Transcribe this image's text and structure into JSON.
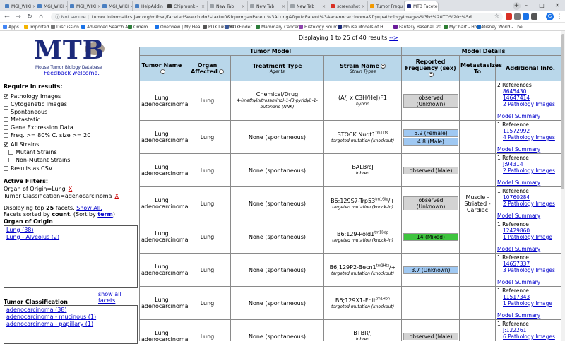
{
  "browser": {
    "tabs": [
      {
        "title": "MGI_WIKI",
        "color": "#4a7fc1"
      },
      {
        "title": "MGI_WIKI",
        "color": "#4a7fc1"
      },
      {
        "title": "MGI_WIKI",
        "color": "#4a7fc1"
      },
      {
        "title": "MGI_WIKI",
        "color": "#4a7fc1"
      },
      {
        "title": "HelpAddin",
        "color": "#4a7fc1"
      },
      {
        "title": "Chipmunk -",
        "color": "#444444"
      },
      {
        "title": "New Tab",
        "color": "#9aa0a6"
      },
      {
        "title": "New Tab",
        "color": "#9aa0a6"
      },
      {
        "title": "New Tab",
        "color": "#9aa0a6"
      },
      {
        "title": "screenshot",
        "color": "#d93025"
      },
      {
        "title": "Tumor Frequ",
        "color": "#f29900"
      },
      {
        "title": "MTB Facete",
        "color": "#1c2a7a"
      }
    ],
    "secure_label": "Not secure",
    "url": "tumor.informatics.jax.org/mtbwi/facetedSearch.do?start=0&fq=organParent%3ALung&fq=tcParent%3Aadenocarcinoma&fq=pathologyImages%3b*%20TO%20*%5d",
    "avatar_letter": "G",
    "bookmarks": [
      {
        "label": "Apps",
        "color": "#4285f4"
      },
      {
        "label": "Imported",
        "color": "#f4b400"
      },
      {
        "label": "Discussion",
        "color": "#777777"
      },
      {
        "label": "Advanced Search A...",
        "color": "#1a73e8"
      },
      {
        "label": "Omero",
        "color": "#2d7d3a"
      },
      {
        "label": "Overview | My Heal...",
        "color": "#1a73e8"
      },
      {
        "label": "PDX Like Me",
        "color": "#555555"
      },
      {
        "label": "PDXFinder",
        "color": "#3b5998"
      },
      {
        "label": "Mammary Cancer I...",
        "color": "#2d7d3a"
      },
      {
        "label": "Histology Sources",
        "color": "#8e44ad"
      },
      {
        "label": "Mouse Models of H...",
        "color": "#1c2a7a"
      },
      {
        "label": "Fantasy Baseball 20...",
        "color": "#6a1b9a"
      },
      {
        "label": "MyChart - Home",
        "color": "#2e7d32"
      },
      {
        "label": "Disney World - The...",
        "color": "#1565c0"
      }
    ]
  },
  "sidebar": {
    "logo_text": "MTB",
    "logo_sub": "Mouse Tumor Biology Database",
    "feedback": "Feedback welcome.",
    "require_title": "Require in results:",
    "options": [
      {
        "label": "Pathology Images",
        "checked": true
      },
      {
        "label": "Cytogenetic Images",
        "checked": false
      },
      {
        "label": "Spontaneous",
        "checked": false
      },
      {
        "label": "Metastatic",
        "checked": false
      },
      {
        "label": "Gene Expression Data",
        "checked": false
      },
      {
        "label": "Freq. >= 80% C. size >= 20",
        "checked": false
      },
      {
        "label": "All Strains",
        "checked": true
      },
      {
        "label": "Mutant Strains",
        "checked": false
      },
      {
        "label": "Non-Mutant Strains",
        "checked": false
      },
      {
        "label": "Results as CSV",
        "checked": false
      }
    ],
    "active_filters_title": "Active Filters:",
    "filter1": "Organ of Origin=Lung",
    "filter2": "Tumor Classification=adenocarcinoma",
    "remove_label": "X",
    "display_top_prefix": "Displaying top ",
    "display_top_count": "25",
    "display_top_suffix": " facets. ",
    "show_all": "Show All.",
    "sorted_prefix": "Facets sorted by ",
    "sorted_by": "count",
    "sorted_mid": ". (Sort by ",
    "sorted_alt": "term",
    "sorted_end": ")",
    "organ_title": "Organ of Origin",
    "organ_facets": [
      "Lung (38)",
      "Lung - Alveolus (2)"
    ],
    "show_all_facets": "show all facets",
    "tumor_title": "Tumor Classification",
    "tumor_facets": [
      "adenocarcinoma (38)",
      "adenocarcinoma - mucinous (1)",
      "adenocarcinoma - papillary (1)"
    ]
  },
  "results": {
    "display_text": "Displaying 1 to 25 of 40 results",
    "next_arrow": "-->",
    "group_tumor_model": "Tumor Model",
    "group_model_details": "Model Details",
    "col_tumor_name": "Tumor Name",
    "col_organ": "Organ Affected",
    "col_treatment": "Treatment Type",
    "col_treatment_sub": "Agents",
    "col_strain": "Strain Name",
    "col_strain_sub": "Strain Types",
    "col_freq": "Reported Frequency (sex)",
    "col_meta": "Metastasizes To",
    "col_info": "Additional Info.",
    "rows": [
      {
        "tumor": "Lung adenocarcinoma",
        "organ": "Lung",
        "treatment": "Chemical/Drug",
        "agents": "4-(methylnitrosamino)-1-(3-pyridyl)-1-butanone (NNK)",
        "strain": "(A/J x C3H/HeJ)F1",
        "strain_sup": "",
        "strain_suffix": "",
        "strain_type": "hybrid",
        "freqs": [
          {
            "text": "observed (Unknown)",
            "color": "grey"
          }
        ],
        "meta": "",
        "refs": "2 References",
        "ids": [
          "8645430",
          "14647414"
        ],
        "images": "2 Pathology Images",
        "summary": "Model Summary"
      },
      {
        "tumor": "Lung adenocarcinoma",
        "organ": "Lung",
        "treatment": "None (spontaneous)",
        "agents": "",
        "strain": "STOCK Nudt1",
        "strain_sup": "tm1Tts",
        "strain_suffix": "",
        "strain_type": "targeted mutation (knockout)",
        "freqs": [
          {
            "text": "5.9 (Female)",
            "color": "blue"
          },
          {
            "text": "4.8 (Male)",
            "color": "blue"
          }
        ],
        "meta": "",
        "refs": "1 Reference",
        "ids": [
          "11572992"
        ],
        "images": "4 Pathology Images",
        "summary": "Model Summary"
      },
      {
        "tumor": "Lung adenocarcinoma",
        "organ": "Lung",
        "treatment": "None (spontaneous)",
        "agents": "",
        "strain": "BALB/cJ",
        "strain_sup": "",
        "strain_suffix": "",
        "strain_type": "inbred",
        "freqs": [
          {
            "text": "observed (Male)",
            "color": "grey"
          }
        ],
        "meta": "",
        "refs": "1 Reference",
        "ids": [
          "J:94314"
        ],
        "images": "2 Pathology Images",
        "summary": "Model Summary"
      },
      {
        "tumor": "Lung adenocarcinoma",
        "organ": "Lung",
        "treatment": "None (spontaneous)",
        "agents": "",
        "strain": "B6;129S7-Trp53",
        "strain_sup": "tm1Glo",
        "strain_suffix": "/+",
        "strain_type": "targeted mutation (knock-in)",
        "freqs": [
          {
            "text": "observed (Unknown)",
            "color": "grey"
          }
        ],
        "meta": "Muscle - Striated - Cardiac",
        "refs": "1 Reference",
        "ids": [
          "10760284"
        ],
        "images": "2 Pathology Images",
        "summary": "Model Summary"
      },
      {
        "tumor": "Lung adenocarcinoma",
        "organ": "Lung",
        "treatment": "None (spontaneous)",
        "agents": "",
        "strain": "B6;129-Pold1",
        "strain_sup": "tm1Bdp",
        "strain_suffix": "",
        "strain_type": "targeted mutation (knock-in)",
        "freqs": [
          {
            "text": "14 (Mixed)",
            "color": "green"
          }
        ],
        "meta": "",
        "refs": "1 Reference",
        "ids": [
          "12429860"
        ],
        "images": "1 Pathology Image",
        "summary": "Model Summary"
      },
      {
        "tumor": "Lung adenocarcinoma",
        "organ": "Lung",
        "treatment": "None (spontaneous)",
        "agents": "",
        "strain": "B6;129P2-Becn1",
        "strain_sup": "tm1Htz",
        "strain_suffix": "/+",
        "strain_type": "targeted mutation (knockout)",
        "freqs": [
          {
            "text": "3.7 (Unknown)",
            "color": "blue"
          }
        ],
        "meta": "",
        "refs": "1 Reference",
        "ids": [
          "14657337"
        ],
        "images": "3 Pathology Images",
        "summary": "Model Summary"
      },
      {
        "tumor": "Lung adenocarcinoma",
        "organ": "Lung",
        "treatment": "None (spontaneous)",
        "agents": "",
        "strain": "B6;129X1-Fhit",
        "strain_sup": "tm1Hbn",
        "strain_suffix": "",
        "strain_type": "targeted mutation (knockout)",
        "freqs": [],
        "meta": "",
        "refs": "1 Reference",
        "ids": [
          "11517343"
        ],
        "images": "1 Pathology Image",
        "summary": "Model Summary"
      },
      {
        "tumor": "Lung adenocarcinoma",
        "organ": "Lung",
        "treatment": "None (spontaneous)",
        "agents": "",
        "strain": "BTBR/J",
        "strain_sup": "",
        "strain_suffix": "",
        "strain_type": "inbred",
        "freqs": [
          {
            "text": "observed (Male)",
            "color": "grey"
          }
        ],
        "meta": "",
        "refs": "1 Reference",
        "ids": [
          "J:122261"
        ],
        "images": "6 Pathology Images",
        "summary": "Model Summary"
      }
    ]
  }
}
